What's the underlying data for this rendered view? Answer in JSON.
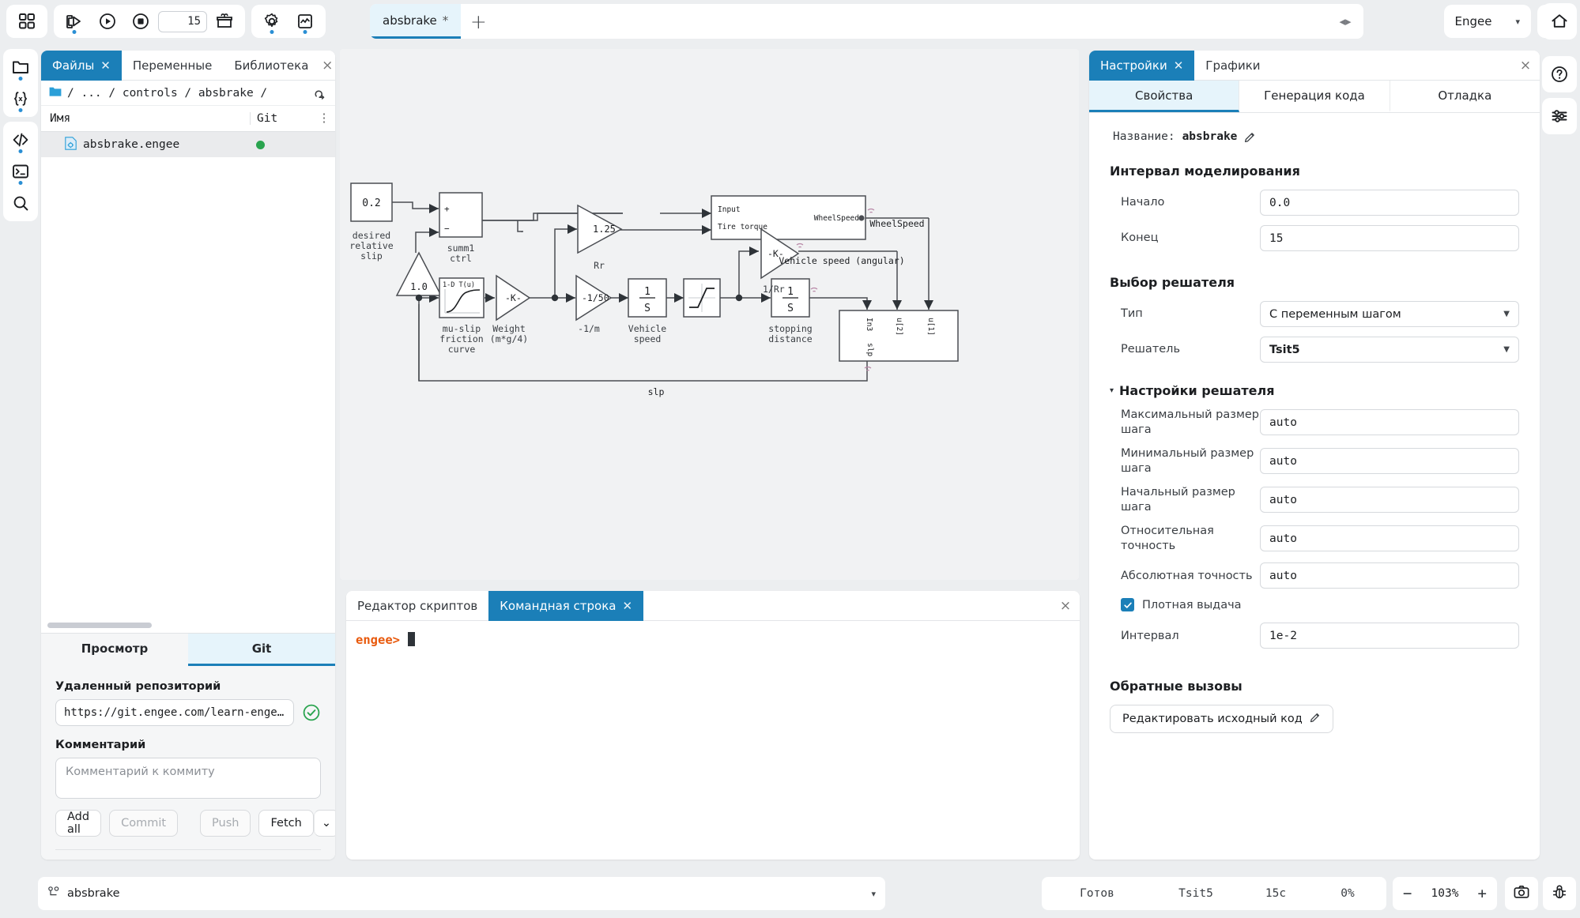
{
  "toolbar": {
    "apps_icon": "grid-apps-icon",
    "run_export_icon": "run-export-icon",
    "play_icon": "play-icon",
    "stop_icon": "stop-icon",
    "sim_time_value": "15",
    "package_icon": "package-icon",
    "settings_icon": "gear-icon",
    "scope_icon": "scope-icon",
    "account_label": "Engee",
    "account_caret": "▾",
    "copilot_icon": "copilot-hex-icon",
    "home_icon": "home-icon",
    "help_icon": "help-circle-icon",
    "prefs_icon": "sliders-icon"
  },
  "left_rail": {
    "items": [
      {
        "name": "sidebar-item-files",
        "icon": "folder-open-icon",
        "dot": true
      },
      {
        "name": "sidebar-item-variables",
        "icon": "variables-braces-icon",
        "dot": true
      },
      {
        "name": "sidebar-item-code",
        "icon": "code-brackets-icon",
        "dot": true
      },
      {
        "name": "sidebar-item-terminal",
        "icon": "terminal-icon",
        "dot": true
      },
      {
        "name": "sidebar-item-search",
        "icon": "search-icon",
        "dot": false
      }
    ]
  },
  "left_panel": {
    "tabs": [
      {
        "label": "Файлы",
        "closable": true,
        "active": true
      },
      {
        "label": "Переменные",
        "closable": false,
        "active": false
      },
      {
        "label": "Библиотека",
        "closable": false,
        "active": false
      }
    ],
    "close_all_glyph": "×",
    "breadcrumb": "/ ... / controls / absbrake /",
    "folder_icon": "folder-icon",
    "refresh_icon": "refresh-cloud-icon",
    "columns": {
      "name": "Имя",
      "git": "Git"
    },
    "kebab_glyph": "⋮",
    "files": [
      {
        "name": "absbrake.engee",
        "icon": "engee-file-icon",
        "git_status_color": "#2aa44f"
      }
    ],
    "bottom_tabs": [
      {
        "label": "Просмотр",
        "active": false
      },
      {
        "label": "Git",
        "active": true
      }
    ],
    "git": {
      "remote_label": "Удаленный репозиторий",
      "remote_value": "https://git.engee.com/learn-enge…",
      "remote_ok_icon": "check-circle-icon",
      "comment_label": "Комментарий",
      "comment_placeholder": "Комментарий к коммиту",
      "comment_value": "",
      "buttons": [
        {
          "label": "Add all",
          "enabled": true
        },
        {
          "label": "Commit",
          "enabled": false
        },
        {
          "label": "Push",
          "enabled": false
        },
        {
          "label": "Fetch",
          "enabled": true
        }
      ],
      "dropdown_glyph": "⌄"
    }
  },
  "canvas_tabs": {
    "tabs": [
      {
        "label": "absbrake",
        "modified_glyph": "*",
        "active": true
      }
    ],
    "add_glyph": "+",
    "nav_glyph": "◂▸"
  },
  "diagram": {
    "blocks": [
      {
        "id": "desired-relative-slip",
        "label": "0.2",
        "caption": "desired\nrelative\nslip"
      },
      {
        "id": "summ1-ctrl",
        "label": "",
        "ports": [
          "+",
          "-"
        ],
        "caption": "summ1\nctrl"
      },
      {
        "id": "gain-1-0",
        "label": "1.0",
        "caption": ""
      },
      {
        "id": "gain-rr",
        "label": "1.25",
        "caption": "Rr"
      },
      {
        "id": "mu-slip-friction-curve",
        "label": "1-D T(u)",
        "caption": "mu-slip\nfriction\ncurve"
      },
      {
        "id": "weight-gain",
        "label": "-K-",
        "caption": "Weight\n(m*g/4)"
      },
      {
        "id": "inv-m-gain",
        "label": "-1/50",
        "caption": "-1/m"
      },
      {
        "id": "vehicle-speed-integrator",
        "label": "1\nS",
        "caption": "Vehicle\nspeed"
      },
      {
        "id": "saturation-block",
        "label": "",
        "caption": ""
      },
      {
        "id": "stopping-distance-integrator",
        "label": "1\nS",
        "caption": "stopping\ndistance"
      },
      {
        "id": "wheel-subsystem",
        "inputs": [
          "Input",
          "Tire torque"
        ],
        "outputs": [
          "WheelSpeed"
        ]
      },
      {
        "id": "inv-rr-gain",
        "label": "-K-",
        "caption": "1/Rr"
      },
      {
        "id": "slip-subsystem",
        "inputs": [
          "In3",
          "u[2]",
          "u[1]"
        ],
        "outputs": [
          "slp"
        ]
      }
    ],
    "signal_labels": [
      "WheelSpeed",
      "Vehicle speed (angular)",
      "slp"
    ]
  },
  "console": {
    "tabs": [
      {
        "label": "Редактор скриптов",
        "closable": false,
        "active": false
      },
      {
        "label": "Командная строка",
        "closable": true,
        "active": true
      }
    ],
    "close_all_glyph": "×",
    "prompt": "engee>",
    "input_value": ""
  },
  "right_panel": {
    "tabs": [
      {
        "label": "Настройки",
        "closable": true,
        "active": true
      },
      {
        "label": "Графики",
        "closable": false,
        "active": false
      }
    ],
    "close_all_glyph": "×",
    "subtabs": [
      {
        "label": "Свойства",
        "active": true
      },
      {
        "label": "Генерация кода",
        "active": false
      },
      {
        "label": "Отладка",
        "active": false
      }
    ],
    "name_label": "Название:",
    "name_value": "absbrake",
    "pencil_icon": "pencil-icon",
    "sim_interval": {
      "title": "Интервал моделирования",
      "fields": [
        {
          "label": "Начало",
          "value": "0.0"
        },
        {
          "label": "Конец",
          "value": "15"
        }
      ]
    },
    "solver_choice": {
      "title": "Выбор решателя",
      "fields": [
        {
          "label": "Тип",
          "value": "С переменным шагом",
          "type": "select"
        },
        {
          "label": "Решатель",
          "value": "Tsit5",
          "type": "select"
        }
      ]
    },
    "solver_settings": {
      "title": "Настройки решателя",
      "caret": "▾",
      "fields": [
        {
          "label": "Максимальный размер шага",
          "value": "auto"
        },
        {
          "label": "Минимальный размер шага",
          "value": "auto"
        },
        {
          "label": "Начальный размер шага",
          "value": "auto"
        },
        {
          "label": "Относительная точность",
          "value": "auto"
        },
        {
          "label": "Абсолютная точность",
          "value": "auto"
        }
      ],
      "checkbox": {
        "label": "Плотная выдача",
        "checked": true
      },
      "interval_field": {
        "label": "Интервал",
        "value": "1e-2"
      }
    },
    "callbacks": {
      "title": "Обратные вызовы",
      "button_label": "Редактировать исходный код",
      "button_icon": "pencil-icon"
    }
  },
  "bottom_bar": {
    "model_icon": "model-hierarchy-icon",
    "model_name": "absbrake",
    "model_caret": "▾",
    "status": "Готов",
    "solver": "Tsit5",
    "time": "15с",
    "progress": "0%",
    "zoom_minus": "−",
    "zoom_value": "103%",
    "zoom_plus": "+",
    "camera_icon": "camera-icon",
    "bug_icon": "bug-icon"
  },
  "colors": {
    "accent": "#1b7fb8",
    "accent_light": "#e6f4fb",
    "dot": "#2a8fd4",
    "git_ok": "#2aa44f",
    "prompt": "#e8590c",
    "canvas_bg": "#f1f2f3"
  }
}
